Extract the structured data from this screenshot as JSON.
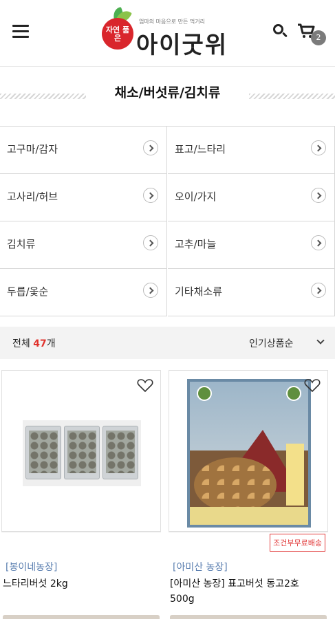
{
  "header": {
    "logo": {
      "badge_text": "자연 품은",
      "tagline": "엄마의 마음으로 만든 먹거리",
      "name": "아이굿위"
    },
    "cart_count": "2"
  },
  "page_title": "채소/버섯류/김치류",
  "categories": [
    {
      "label": "고구마/감자"
    },
    {
      "label": "표고/느타리"
    },
    {
      "label": "고사리/허브"
    },
    {
      "label": "오이/가지"
    },
    {
      "label": "김치류"
    },
    {
      "label": "고추/마늘"
    },
    {
      "label": "두릅/옻순"
    },
    {
      "label": "기타채소류"
    }
  ],
  "listing": {
    "total_prefix": "전체",
    "total_count": "47",
    "total_suffix": "개",
    "sort_label": "인기상품순"
  },
  "products": [
    {
      "farm": "[봉이네농장]",
      "name": "느타리버섯 2kg",
      "badge": ""
    },
    {
      "farm": "[아미산 농장]",
      "name": "[아미산 농장] 표고버섯 동고2호 500g",
      "badge": "조건부무료배송"
    }
  ],
  "colors": {
    "accent_red": "#e0322c",
    "farm_blue": "#5b7fb0",
    "badge_red": "#e23a3a"
  }
}
